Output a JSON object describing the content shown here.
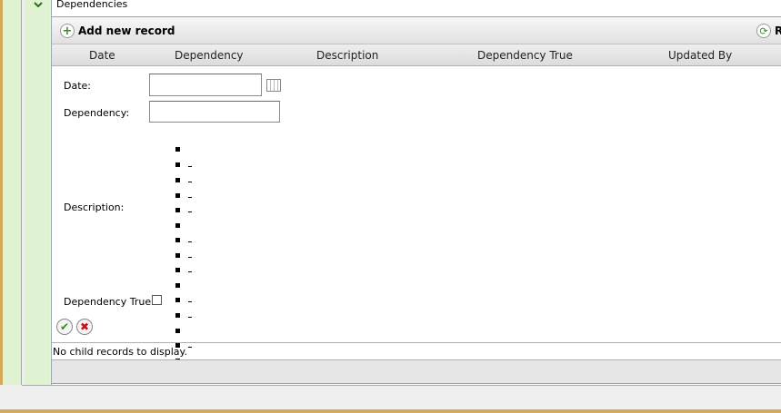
{
  "section": {
    "title": "Dependencies"
  },
  "toolbar": {
    "add_label": "Add new record",
    "refresh_label": "R"
  },
  "columns": [
    "Date",
    "Dependency",
    "Description",
    "Dependency True",
    "Updated By"
  ],
  "form": {
    "date_label": "Date:",
    "date_value": "",
    "dependency_label": "Dependency:",
    "dependency_value": "",
    "description_label": "Description:",
    "dependency_true_label": "Dependency True:"
  },
  "grid": {
    "no_records": "No child records to display."
  },
  "icons": {
    "expand": "chevron-down-icon",
    "add": "plus-icon",
    "refresh": "refresh-icon",
    "calendar": "calendar-icon",
    "save": "checkmark-icon",
    "cancel": "x-icon"
  },
  "colors": {
    "accent_green": "#dff3d2",
    "border_orange": "#d4a95a",
    "ok_green": "#2f8f1f",
    "cancel_red": "#cc1111"
  }
}
